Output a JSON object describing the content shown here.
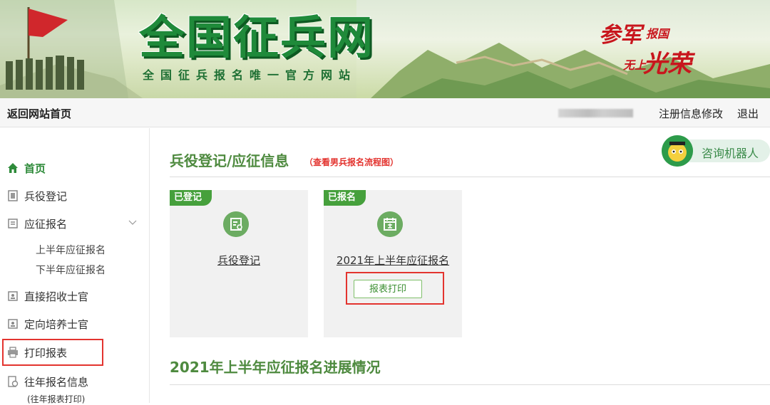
{
  "banner": {
    "title": "全国征兵网",
    "subtitle": "全国征兵报名唯一官方网站",
    "slogan": {
      "part1": "参军",
      "part2": "报国",
      "part3": "无上",
      "part4": "光荣"
    }
  },
  "topbar": {
    "back_home": "返回网站首页",
    "register_edit": "注册信息修改",
    "logout": "退出"
  },
  "sidebar": {
    "items": [
      {
        "label": "首页",
        "icon": "home-icon",
        "active": true
      },
      {
        "label": "兵役登记",
        "icon": "document-icon"
      },
      {
        "label": "应征报名",
        "icon": "form-icon"
      },
      {
        "label": "直接招收士官",
        "icon": "id-card-icon"
      },
      {
        "label": "定向培养士官",
        "icon": "id-card-icon"
      },
      {
        "label": "打印报表",
        "icon": "printer-icon"
      },
      {
        "label": "往年报名信息",
        "icon": "history-icon"
      }
    ],
    "subitems": [
      "上半年应征报名",
      "下半年应征报名"
    ],
    "history_sub": "(往年报表打印)"
  },
  "main": {
    "title": "兵役登记/应征信息",
    "flow_link": "（查看男兵报名流程图）",
    "robot_label": "咨询机器人",
    "cards": [
      {
        "badge": "已登记",
        "link": "兵役登记",
        "icon": "registration-icon"
      },
      {
        "badge": "已报名",
        "link": "2021年上半年应征报名",
        "icon": "calendar-icon",
        "button": "报表打印"
      }
    ],
    "progress_title": "2021年上半年应征报名进展情况"
  },
  "colors": {
    "accent_green": "#4e8a3f",
    "highlight_red": "#e3342f",
    "badge_green": "#46a03c"
  }
}
